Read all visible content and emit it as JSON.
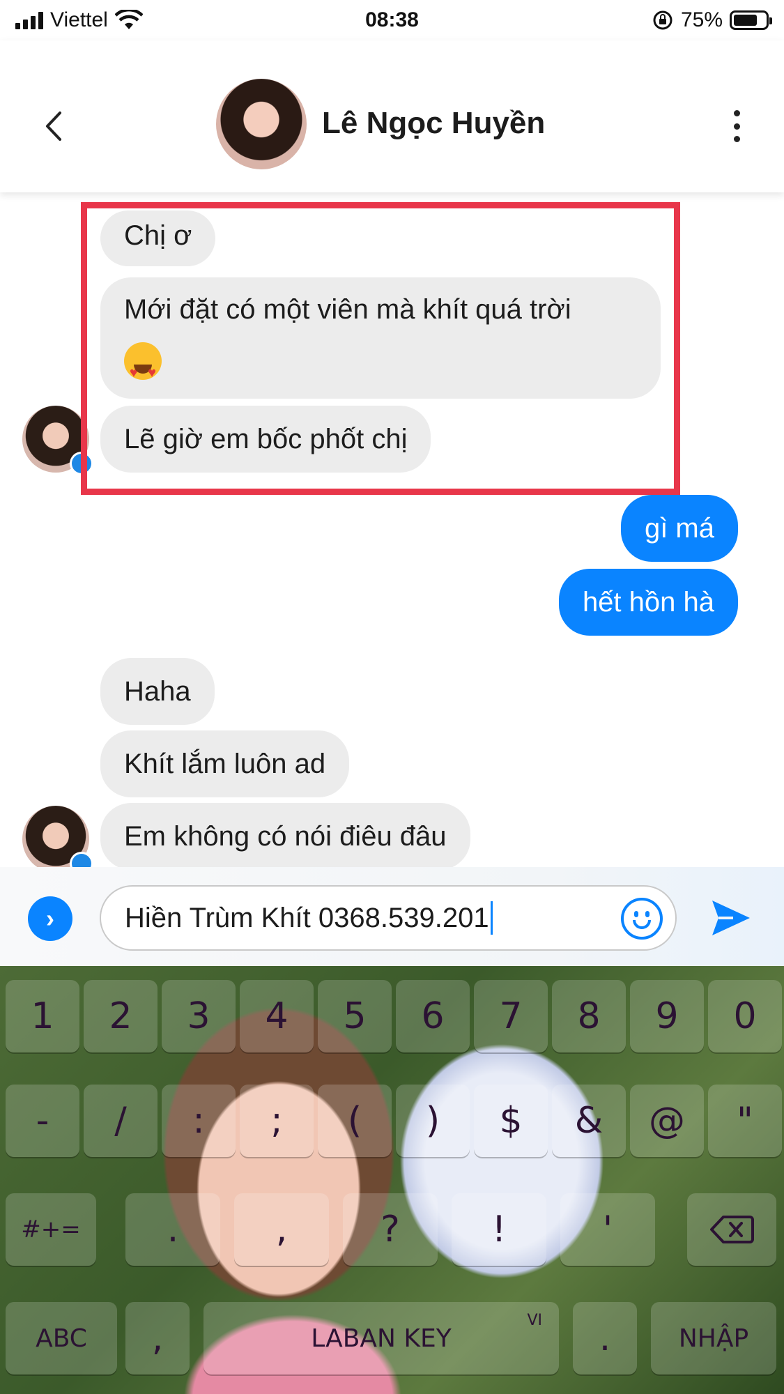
{
  "status_bar": {
    "carrier": "Viettel",
    "time": "08:38",
    "battery": "75%",
    "battery_level": 0.75
  },
  "header": {
    "contact_name": "Lê Ngọc Huyền"
  },
  "messages_incoming_1": [
    "Chị ơ",
    "Mới đặt có một viên mà khít quá trời",
    "Lẽ giờ em bốc phốt chị"
  ],
  "messages_outgoing": [
    "gì má",
    "hết hồn hà"
  ],
  "messages_incoming_2": [
    "Haha",
    "Khít lắm luôn ad",
    "Em không có nói điêu đâu"
  ],
  "composer": {
    "text": "Hiền Trùm Khít 0368.539.201"
  },
  "keyboard": {
    "row1": [
      "1",
      "2",
      "3",
      "4",
      "5",
      "6",
      "7",
      "8",
      "9",
      "0"
    ],
    "row2": [
      "-",
      "/",
      ":",
      ";",
      "(",
      ")",
      "$",
      "&",
      "@",
      "\""
    ],
    "row3": [
      "#+=",
      ".",
      ",",
      "?",
      "!",
      "'"
    ],
    "abc": "ABC",
    "comma": ",",
    "space": "LABAN KEY",
    "lang": "VI",
    "period": ".",
    "enter": "NHẬP"
  },
  "colors": {
    "accent": "#0a84ff",
    "incoming_bubble": "#ececec",
    "highlight": "#e8364a"
  }
}
